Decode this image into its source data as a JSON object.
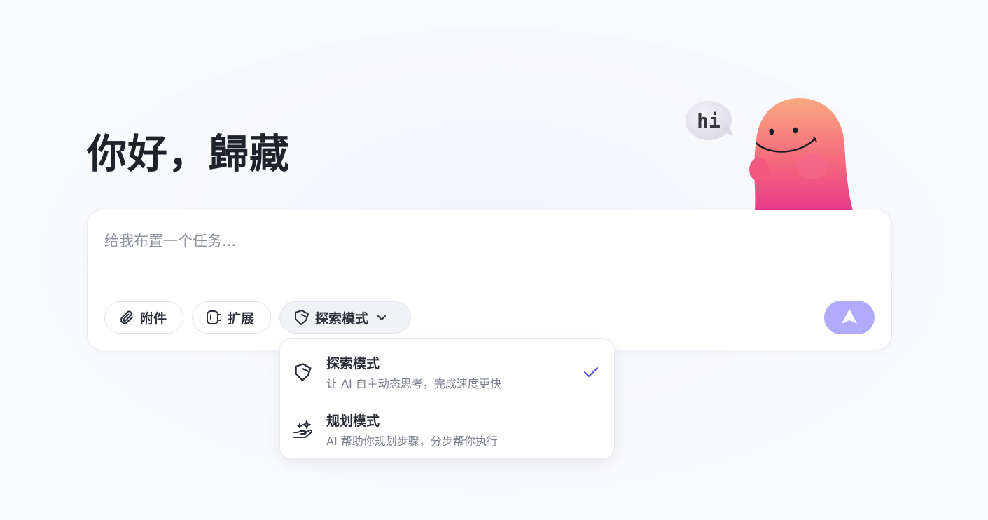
{
  "greeting": "你好，歸藏",
  "mascot": {
    "bubble_text": "hi"
  },
  "composer": {
    "placeholder": "给我布置一个任务...",
    "attach_label": "附件",
    "extension_label": "扩展",
    "mode_label": "探索模式"
  },
  "mode_menu": {
    "options": [
      {
        "title": "探索模式",
        "description": "让 AI 自主动态思考，完成速度更快",
        "icon": "tag-icon",
        "selected": true
      },
      {
        "title": "规划模式",
        "description": "AI 帮助你规划步骤，分步帮你执行",
        "icon": "hand-sparkle-icon",
        "selected": false
      }
    ]
  },
  "colors": {
    "accent": "#5b53e6",
    "send_button": "#b2abfb",
    "mascot_top": "#f8a07e",
    "mascot_bottom": "#ec3d8a"
  }
}
